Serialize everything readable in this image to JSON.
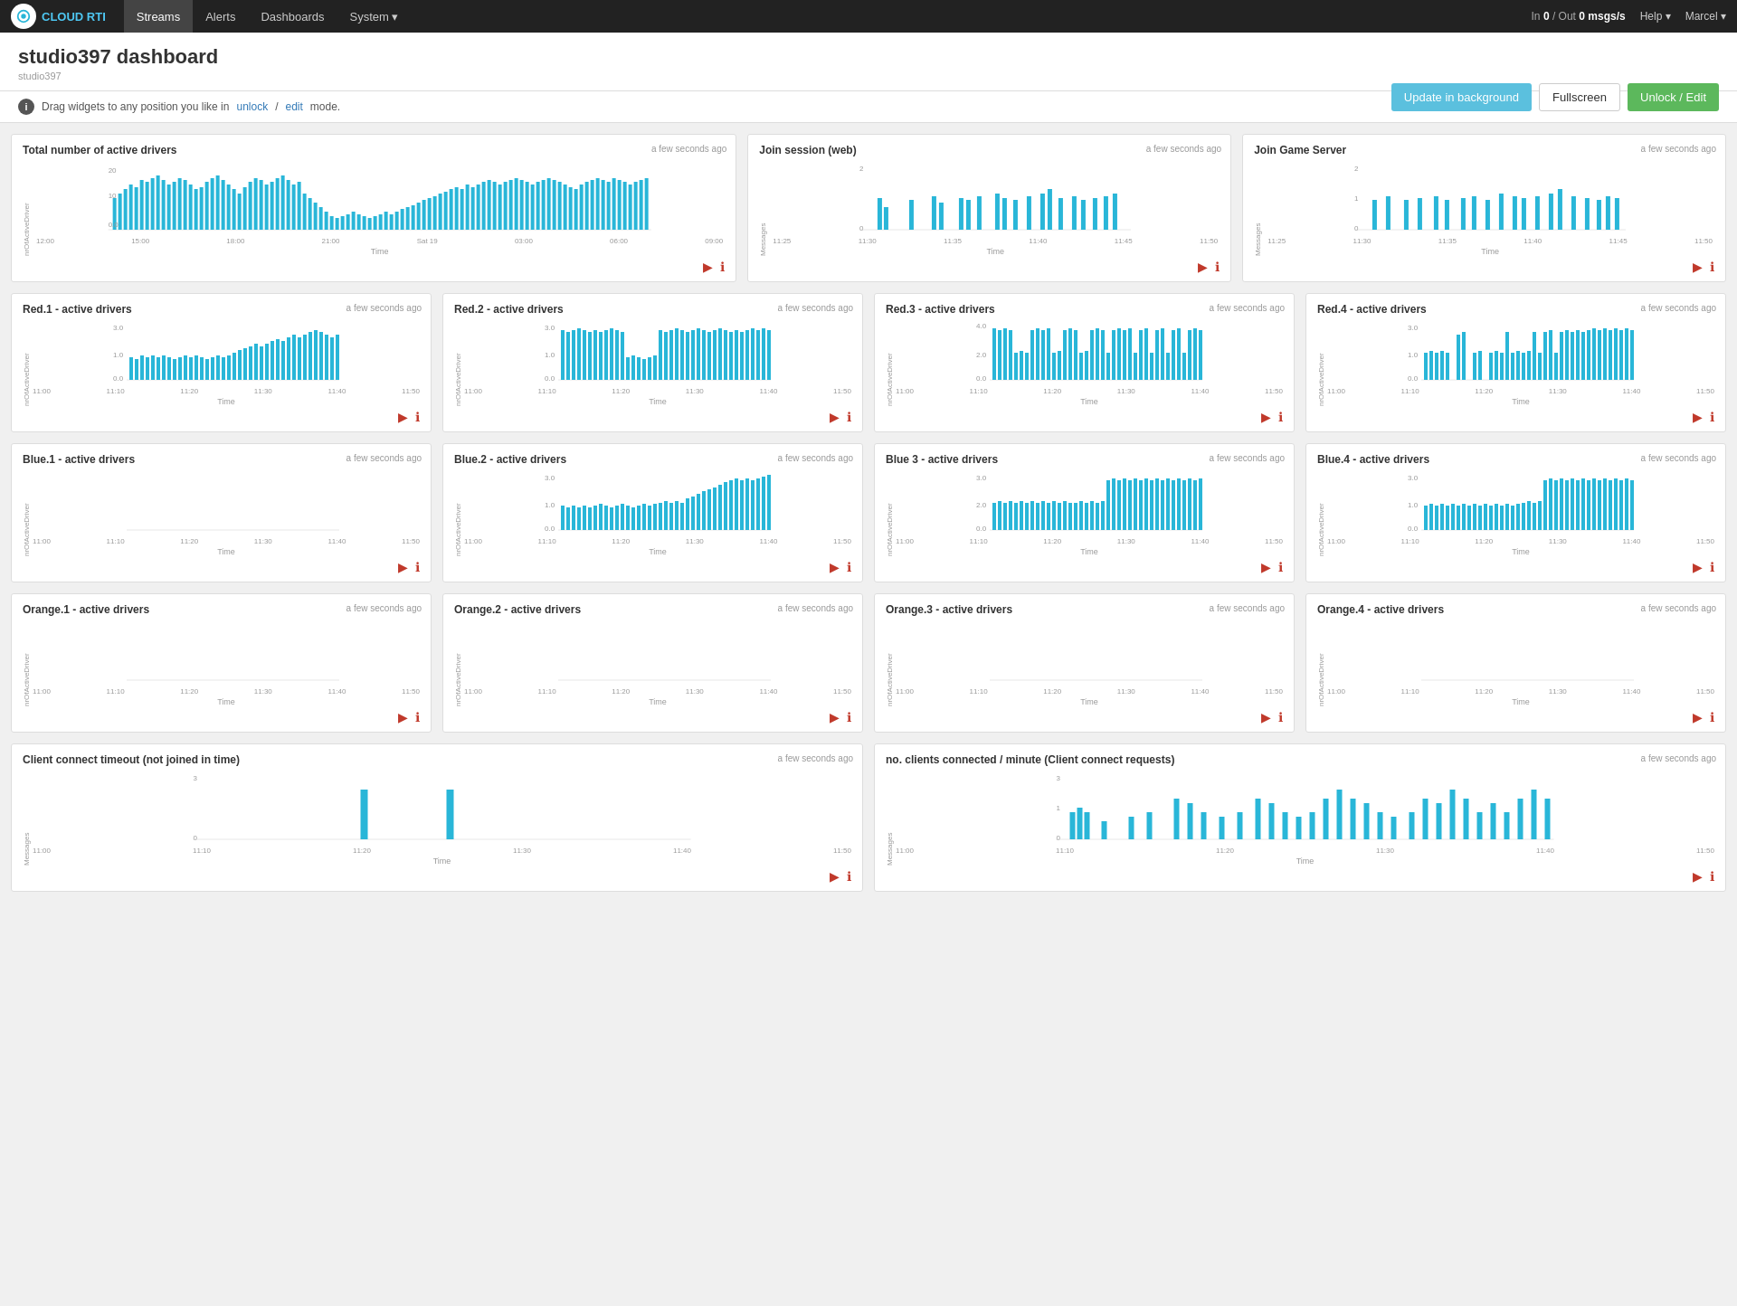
{
  "nav": {
    "brand": "CLOUD RTI",
    "links": [
      "Streams",
      "Alerts",
      "Dashboards",
      "System ▾"
    ],
    "msg_in": "0",
    "msg_out": "0",
    "msg_unit": "msgs/s",
    "help": "Help ▾",
    "user": "Marcel ▾"
  },
  "header": {
    "title": "studio397 dashboard",
    "subtitle": "studio397",
    "btn_update": "Update in background",
    "btn_fullscreen": "Fullscreen",
    "btn_unlock": "Unlock / Edit",
    "info_text": "Drag widgets to any position you like in",
    "info_link_unlock": "unlock",
    "info_link_edit": "edit",
    "info_suffix": "mode."
  },
  "widgets": {
    "total_drivers": {
      "title": "Total number of active drivers",
      "timestamp": "a few seconds ago",
      "y_label": "nrOfActiveDriver",
      "x_label": "Time",
      "y_ticks": [
        "20",
        "10",
        "0.0"
      ],
      "x_ticks": [
        "12:00",
        "15:00",
        "18:00",
        "21:00",
        "Sat 19",
        "03:00",
        "06:00",
        "09:00"
      ]
    },
    "join_session": {
      "title": "Join session (web)",
      "timestamp": "a few seconds ago",
      "y_label": "Messages",
      "x_label": "Time",
      "y_ticks": [
        "2",
        "0"
      ],
      "x_ticks": [
        "11:25",
        "11:30",
        "11:35",
        "11:40",
        "11:45",
        "11:50"
      ]
    },
    "join_game": {
      "title": "Join Game Server",
      "timestamp": "a few seconds ago",
      "y_label": "Messages",
      "x_label": "Time",
      "y_ticks": [
        "2",
        "1",
        "0"
      ],
      "x_ticks": [
        "11:25",
        "11:30",
        "11:35",
        "11:40",
        "11:45",
        "11:50"
      ]
    },
    "red1": {
      "title": "Red.1 - active drivers",
      "timestamp": "a few seconds ago",
      "y_max": "3.0",
      "x_ticks": [
        "11:00",
        "11:10",
        "11:20",
        "11:30",
        "11:40",
        "11:50"
      ]
    },
    "red2": {
      "title": "Red.2 - active drivers",
      "timestamp": "a few seconds ago",
      "y_max": "3.0",
      "x_ticks": [
        "11:00",
        "11:10",
        "11:20",
        "11:30",
        "11:40",
        "11:50"
      ]
    },
    "red3": {
      "title": "Red.3 - active drivers",
      "timestamp": "a few seconds ago",
      "y_max": "4.0",
      "x_ticks": [
        "11:00",
        "11:10",
        "11:20",
        "11:30",
        "11:40",
        "11:50"
      ]
    },
    "red4": {
      "title": "Red.4 - active drivers",
      "timestamp": "a few seconds ago",
      "y_max": "3.0",
      "x_ticks": [
        "11:00",
        "11:10",
        "11:20",
        "11:30",
        "11:40",
        "11:50"
      ]
    },
    "blue1": {
      "title": "Blue.1 - active drivers",
      "timestamp": "a few seconds ago",
      "y_max": "",
      "x_ticks": [
        "11:00",
        "11:10",
        "11:20",
        "11:30",
        "11:40",
        "11:50"
      ]
    },
    "blue2": {
      "title": "Blue.2 - active drivers",
      "timestamp": "a few seconds ago",
      "y_max": "3.0",
      "x_ticks": [
        "11:00",
        "11:10",
        "11:20",
        "11:30",
        "11:40",
        "11:50"
      ]
    },
    "blue3": {
      "title": "Blue 3 - active drivers",
      "timestamp": "a few seconds ago",
      "y_max": "3.0",
      "x_ticks": [
        "11:00",
        "11:10",
        "11:20",
        "11:30",
        "11:40",
        "11:50"
      ]
    },
    "blue4": {
      "title": "Blue.4 - active drivers",
      "timestamp": "a few seconds ago",
      "y_max": "3.0",
      "x_ticks": [
        "11:00",
        "11:10",
        "11:20",
        "11:30",
        "11:40",
        "11:50"
      ]
    },
    "orange1": {
      "title": "Orange.1 - active drivers",
      "timestamp": "a few seconds ago",
      "y_max": "",
      "x_ticks": [
        "11:00",
        "11:10",
        "11:20",
        "11:30",
        "11:40",
        "11:50"
      ]
    },
    "orange2": {
      "title": "Orange.2 - active drivers",
      "timestamp": "a few seconds ago",
      "y_max": "",
      "x_ticks": [
        "11:00",
        "11:10",
        "11:20",
        "11:30",
        "11:40",
        "11:50"
      ]
    },
    "orange3": {
      "title": "Orange.3 - active drivers",
      "timestamp": "a few seconds ago",
      "y_max": "",
      "x_ticks": [
        "11:00",
        "11:10",
        "11:20",
        "11:30",
        "11:40",
        "11:50"
      ]
    },
    "orange4": {
      "title": "Orange.4 - active drivers",
      "timestamp": "a few seconds ago",
      "y_max": "",
      "x_ticks": [
        "11:00",
        "11:10",
        "11:20",
        "11:30",
        "11:40",
        "11:50"
      ]
    },
    "client_timeout": {
      "title": "Client connect timeout (not joined in time)",
      "timestamp": "a few seconds ago",
      "y_label": "Messages",
      "x_ticks": [
        "11:00",
        "11:10",
        "11:20",
        "11:30",
        "11:40",
        "11:50"
      ]
    },
    "clients_connected": {
      "title": "no. clients connected / minute (Client connect requests)",
      "timestamp": "a few seconds ago",
      "y_label": "Messages",
      "x_ticks": [
        "11:00",
        "11:10",
        "11:20",
        "11:30",
        "11:40",
        "11:50"
      ]
    }
  },
  "colors": {
    "bar_blue": "#29b6d8",
    "bar_red": "#e05050",
    "nav_bg": "#222",
    "card_bg": "#fff",
    "accent_green": "#5cb85c",
    "accent_blue_btn": "#5bc0de"
  }
}
